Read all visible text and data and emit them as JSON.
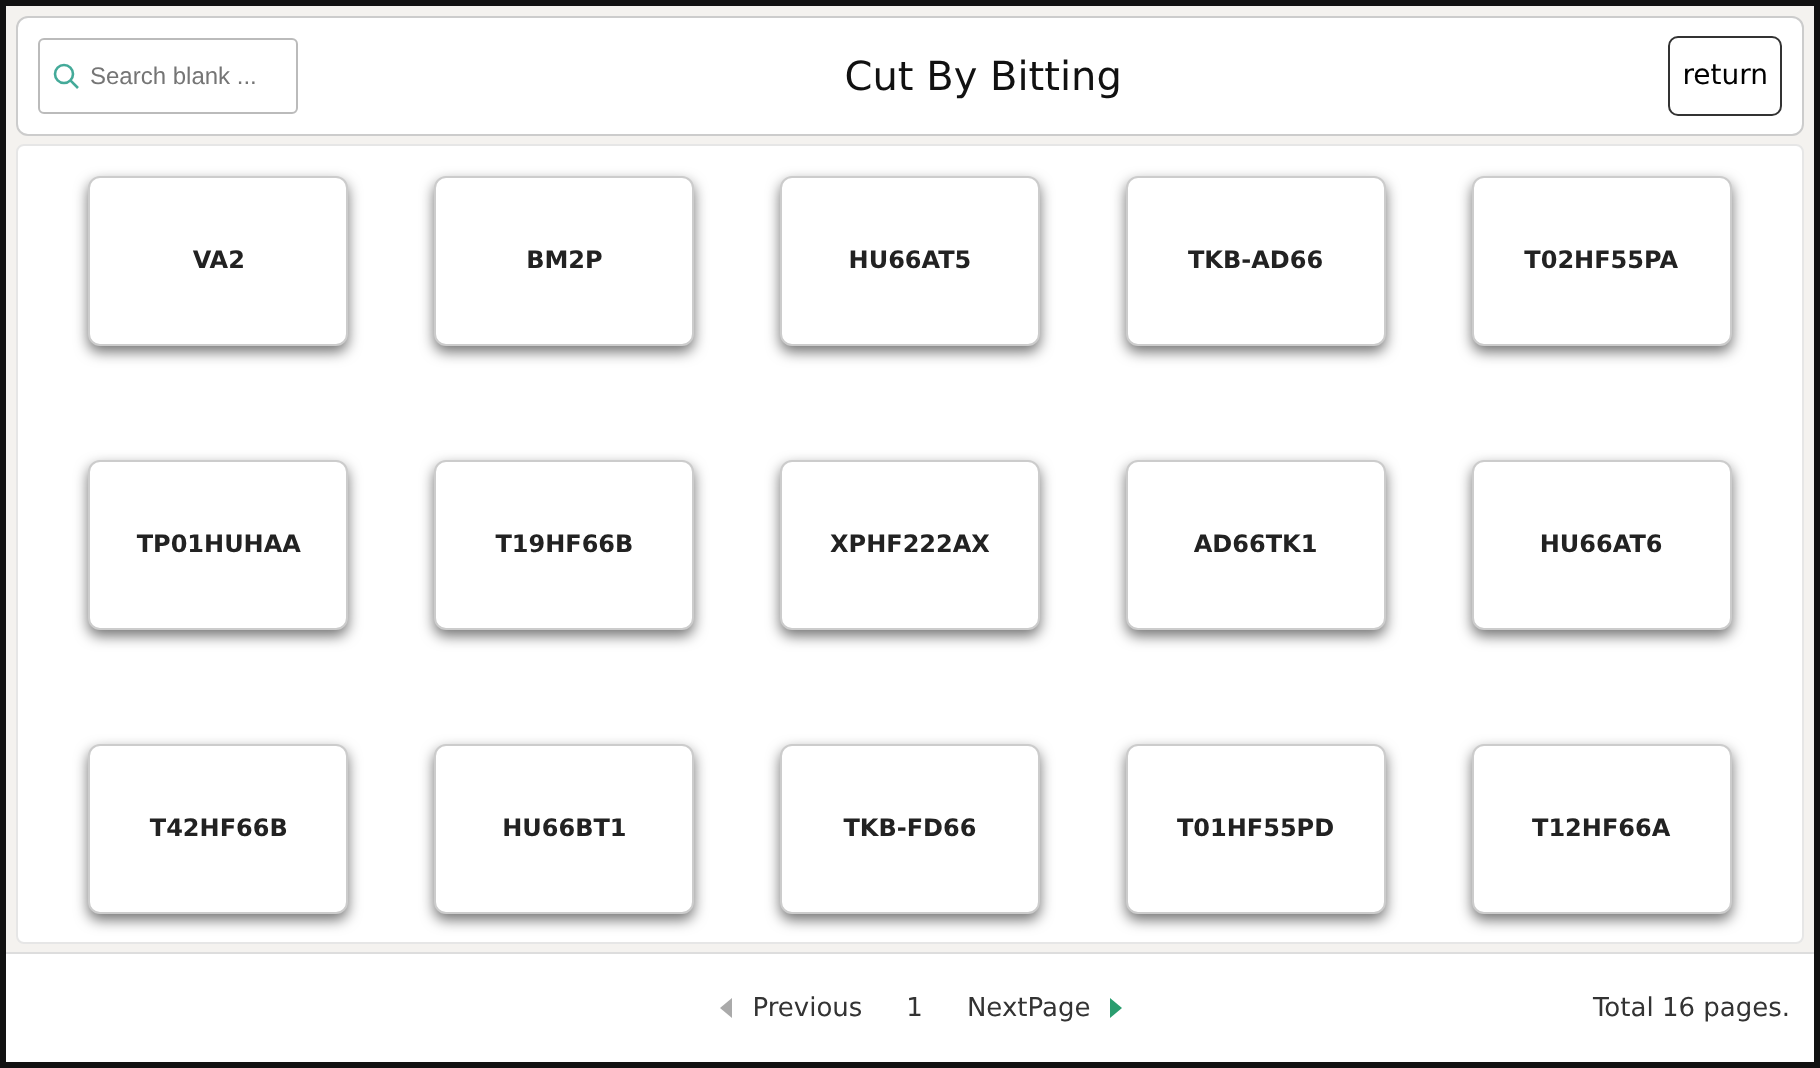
{
  "header": {
    "search": {
      "placeholder": "Search blank ..."
    },
    "title": "Cut By Bitting",
    "return_button": "return"
  },
  "keys": [
    {
      "label": "VA2"
    },
    {
      "label": "BM2P"
    },
    {
      "label": "HU66AT5"
    },
    {
      "label": "TKB-AD66"
    },
    {
      "label": "T02HF55PA"
    },
    {
      "label": "TP01HUHAA"
    },
    {
      "label": "T19HF66B"
    },
    {
      "label": "XPHF222AX"
    },
    {
      "label": "AD66TK1"
    },
    {
      "label": "HU66AT6"
    },
    {
      "label": "T42HF66B"
    },
    {
      "label": "HU66BT1"
    },
    {
      "label": "TKB-FD66"
    },
    {
      "label": "T01HF55PD"
    },
    {
      "label": "T12HF66A"
    }
  ],
  "pagination": {
    "previous": {
      "label": "Previous",
      "disabled": true
    },
    "page": "1",
    "next": {
      "label": "NextPage",
      "disabled": false
    },
    "total": "Total 16 pages."
  }
}
